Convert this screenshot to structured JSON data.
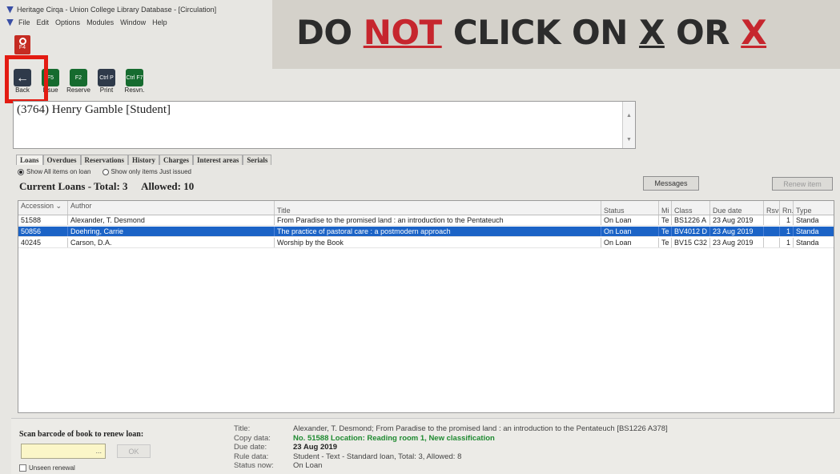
{
  "window": {
    "title": "Heritage Cirqa - Union College Library Database - [Circulation]"
  },
  "menu": [
    "File",
    "Edit",
    "Options",
    "Modules",
    "Window",
    "Help"
  ],
  "search_button": {
    "key": "F4"
  },
  "toolbar": [
    {
      "name": "back",
      "key": "",
      "label": "Back",
      "icon": "arrow-left-icon"
    },
    {
      "name": "issue",
      "key": "F5",
      "label": "Issue",
      "icon": "issue-icon"
    },
    {
      "name": "reserve",
      "key": "F2",
      "label": "Reserve",
      "icon": "reserve-icon"
    },
    {
      "name": "print",
      "key": "Ctrl P",
      "label": "Print",
      "icon": "printer-icon"
    },
    {
      "name": "resvn",
      "key": "Ctrl F7",
      "label": "Resvn.",
      "icon": "reservation-icon"
    }
  ],
  "banner": {
    "part1": "DO ",
    "not": "NOT",
    "part2": " CLICK ON ",
    "x1": "X",
    "part3": " OR ",
    "x2": "X"
  },
  "borrower": {
    "name": "(3764) Henry Gamble [Student]"
  },
  "tabs": [
    "Loans",
    "Overdues",
    "Reservations",
    "History",
    "Charges",
    "Interest areas",
    "Serials"
  ],
  "active_tab": "Loans",
  "filters": {
    "all_label": "Show All items on loan",
    "issued_label": "Show only items Just issued",
    "selected": "all"
  },
  "summary": {
    "current": "Current Loans - Total: 3",
    "allowed": "Allowed: 10"
  },
  "buttons": {
    "messages": "Messages",
    "renew_item": "Renew item"
  },
  "table": {
    "columns": {
      "accession": "Accession",
      "author": "Author",
      "title": "Title",
      "status": "Status",
      "media": "Mi",
      "class": "Class",
      "due": "Due date",
      "rsv": "Rsv",
      "rn": "Rn.",
      "type": "Type"
    },
    "rows": [
      {
        "accession": "51588",
        "author": "Alexander, T. Desmond",
        "title": "From Paradise to the promised land : an introduction to the Pentateuch",
        "status": "On Loan",
        "media": "Te",
        "class": "BS1226 A",
        "due": "23 Aug 2019",
        "rsv": "",
        "rn": "1",
        "type": "Standa",
        "selected": false
      },
      {
        "accession": "50856",
        "author": "Doehring, Carrie",
        "title": "The practice of pastoral care : a postmodern approach",
        "status": "On Loan",
        "media": "Te",
        "class": "BV4012 D",
        "due": "23 Aug 2019",
        "rsv": "",
        "rn": "1",
        "type": "Standa",
        "selected": true
      },
      {
        "accession": "40245",
        "author": "Carson, D.A.",
        "title": "Worship by the Book",
        "status": "On Loan",
        "media": "Te",
        "class": "BV15 C32",
        "due": "23 Aug 2019",
        "rsv": "",
        "rn": "1",
        "type": "Standa",
        "selected": false
      }
    ]
  },
  "renew": {
    "label": "Scan barcode of book to renew loan:",
    "value": "",
    "browse": "...",
    "ok": "OK",
    "unseen": "Unseen renewal"
  },
  "details": {
    "title_label": "Title:",
    "title_value": "Alexander, T. Desmond;  From Paradise to the promised land : an introduction to the Pentateuch  [BS1226 A378]",
    "copy_label": "Copy data:",
    "copy_value": "No. 51588  Location: Reading room 1, New classification",
    "due_label": "Due date:",
    "due_value": "23 Aug 2019",
    "rule_label": "Rule data:",
    "rule_value": "Student - Text - Standard loan,  Total: 3,  Allowed: 8",
    "status_label": "Status now:",
    "status_value": "On Loan"
  }
}
